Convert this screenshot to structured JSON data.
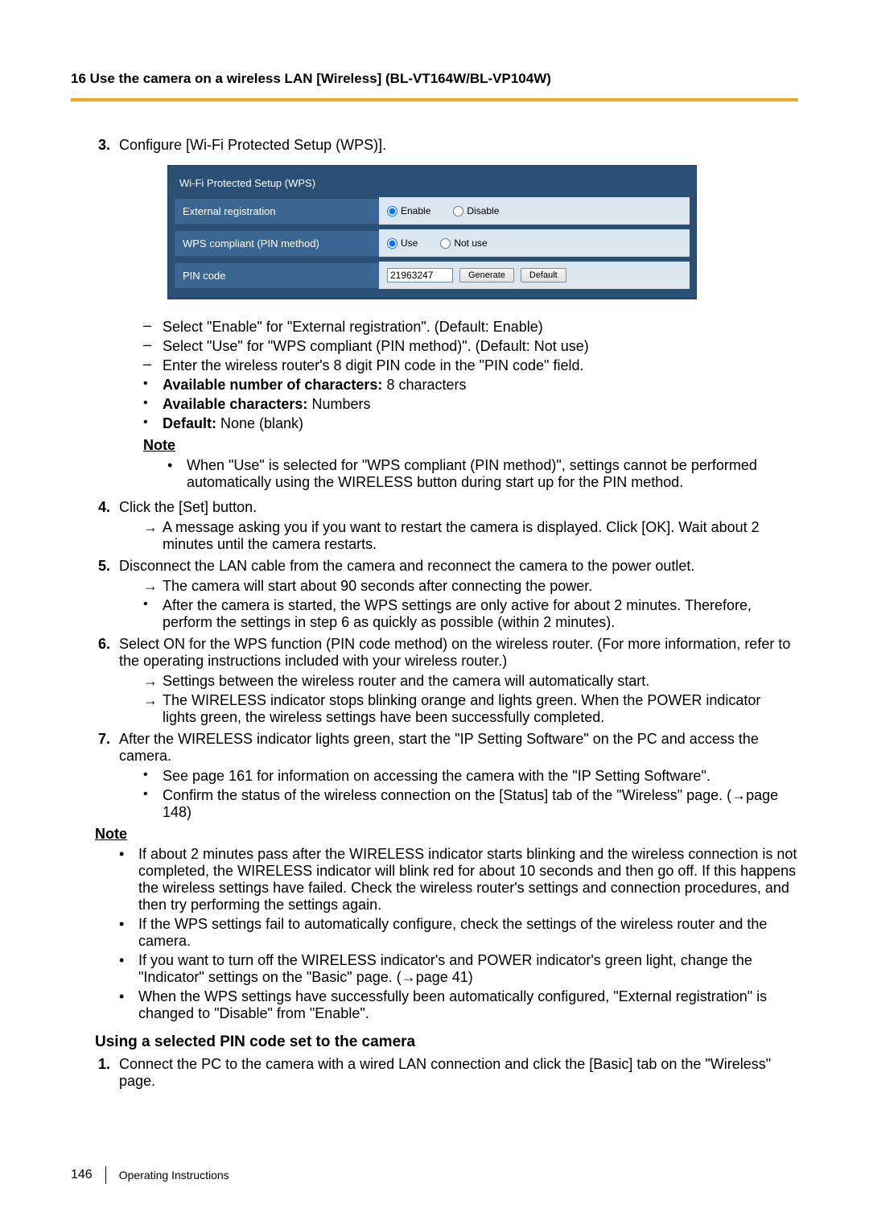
{
  "header": "16 Use the camera on a wireless LAN [Wireless] (BL-VT164W/BL-VP104W)",
  "step3": {
    "text": "Configure [Wi-Fi Protected Setup (WPS)].",
    "panel": {
      "title": "Wi-Fi Protected Setup (WPS)",
      "rows": {
        "ext_reg": {
          "label": "External registration",
          "opt1": "Enable",
          "opt2": "Disable"
        },
        "wps_pin": {
          "label": "WPS compliant (PIN method)",
          "opt1": "Use",
          "opt2": "Not use"
        },
        "pin_code": {
          "label": "PIN code",
          "value": "21963247",
          "btn_generate": "Generate",
          "btn_default": "Default"
        }
      }
    },
    "dash1": "Select \"Enable\" for \"External registration\". (Default: Enable)",
    "dash2": "Select \"Use\" for \"WPS compliant (PIN method)\". (Default: Not use)",
    "dash3": "Enter the wireless router's 8 digit PIN code in the \"PIN code\" field.",
    "b1_label": "Available number of characters:",
    "b1_rest": " 8 characters",
    "b2_label": "Available characters:",
    "b2_rest": " Numbers",
    "b3_label": "Default:",
    "b3_rest": " None (blank)",
    "note_hd": "Note",
    "note1": "When \"Use\" is selected for \"WPS compliant (PIN method)\", settings cannot be performed automatically using the WIRELESS button during start up for the PIN method."
  },
  "step4": {
    "text": "Click the [Set] button.",
    "arrow1": "A message asking you if you want to restart the camera is displayed. Click [OK]. Wait about 2 minutes until the camera restarts."
  },
  "step5": {
    "text": "Disconnect the LAN cable from the camera and reconnect the camera to the power outlet.",
    "arrow1": "The camera will start about 90 seconds after connecting the power.",
    "bullet1": "After the camera is started, the WPS settings are only active for about 2 minutes. Therefore, perform the settings in step 6 as quickly as possible (within 2 minutes)."
  },
  "step6": {
    "text": "Select ON for the WPS function (PIN code method) on the wireless router. (For more information, refer to the operating instructions included with your wireless router.)",
    "arrow1": "Settings between the wireless router and the camera will automatically start.",
    "arrow2": "The WIRELESS indicator stops blinking orange and lights green. When the POWER indicator lights green, the wireless settings have been successfully completed."
  },
  "step7": {
    "text": "After the WIRELESS indicator lights green, start the \"IP Setting Software\" on the PC and access the camera.",
    "bullet1": "See page 161 for information on accessing the camera with the \"IP Setting Software\".",
    "bullet2": "Confirm the status of the wireless connection on the [Status] tab of the \"Wireless\" page. (→page 148)"
  },
  "outer_note": {
    "hd": "Note",
    "n1": "If about 2 minutes pass after the WIRELESS indicator starts blinking and the wireless connection is not completed, the WIRELESS indicator will blink red for about 10 seconds and then go off. If this happens the wireless settings have failed. Check the wireless router's settings and connection procedures, and then try performing the settings again.",
    "n2": "If the WPS settings fail to automatically configure, check the settings of the wireless router and the camera.",
    "n3": "If you want to turn off the WIRELESS indicator's and POWER indicator's green light, change the \"Indicator\" settings on the \"Basic\" page. (→page 41)",
    "n4": "When the WPS settings have successfully been automatically configured, \"External registration\" is changed to \"Disable\" from \"Enable\"."
  },
  "subsection": "Using a selected PIN code set to the camera",
  "sub_step1": "Connect the PC to the camera with a wired LAN connection and click the [Basic] tab on the \"Wireless\" page.",
  "footer": {
    "page": "146",
    "label": "Operating Instructions"
  }
}
